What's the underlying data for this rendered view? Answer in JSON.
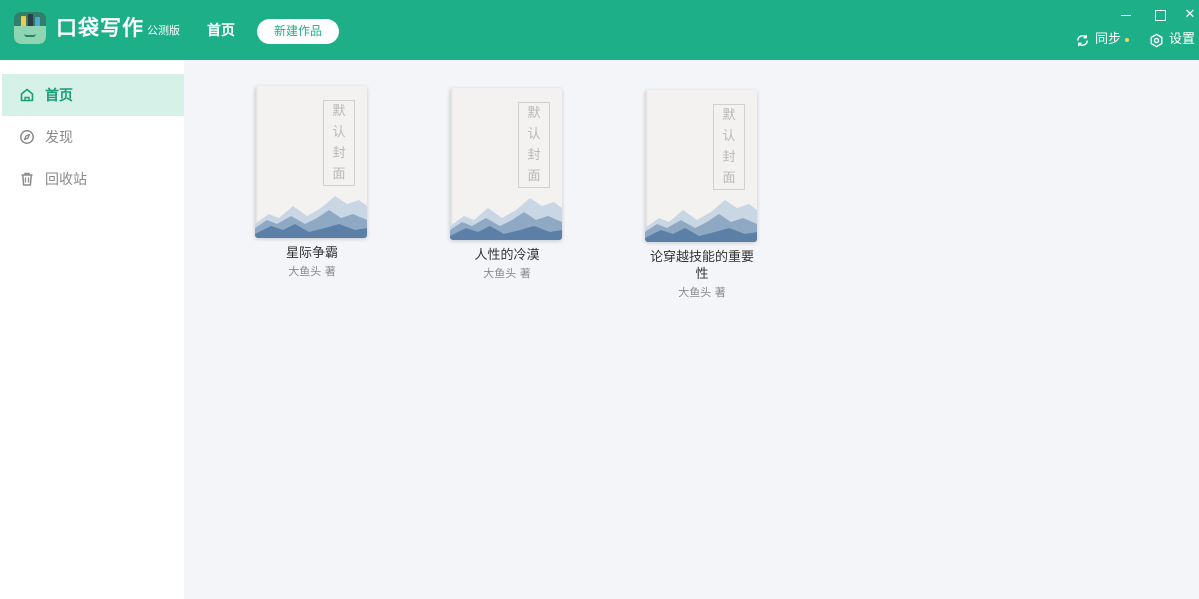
{
  "app": {
    "title": "口袋写作",
    "badge": "公测版"
  },
  "header": {
    "nav_home": "首页",
    "new_work_button": "新建作品",
    "sync_label": "同步",
    "settings_label": "设置",
    "accent_color": "#1db088"
  },
  "sidebar": {
    "items": [
      {
        "label": "首页",
        "icon": "home-icon",
        "active": true
      },
      {
        "label": "发现",
        "icon": "compass-icon",
        "active": false
      },
      {
        "label": "回收站",
        "icon": "trash-icon",
        "active": false
      }
    ]
  },
  "books": [
    {
      "cover_label": [
        "默",
        "认",
        "封",
        "面"
      ],
      "title": "星际争霸",
      "author": "大鱼头 著"
    },
    {
      "cover_label": [
        "默",
        "认",
        "封",
        "面"
      ],
      "title": "人性的冷漠",
      "author": "大鱼头 著"
    },
    {
      "cover_label": [
        "默",
        "认",
        "封",
        "面"
      ],
      "title": "论穿越技能的重要性",
      "author": "大鱼头 著"
    }
  ]
}
